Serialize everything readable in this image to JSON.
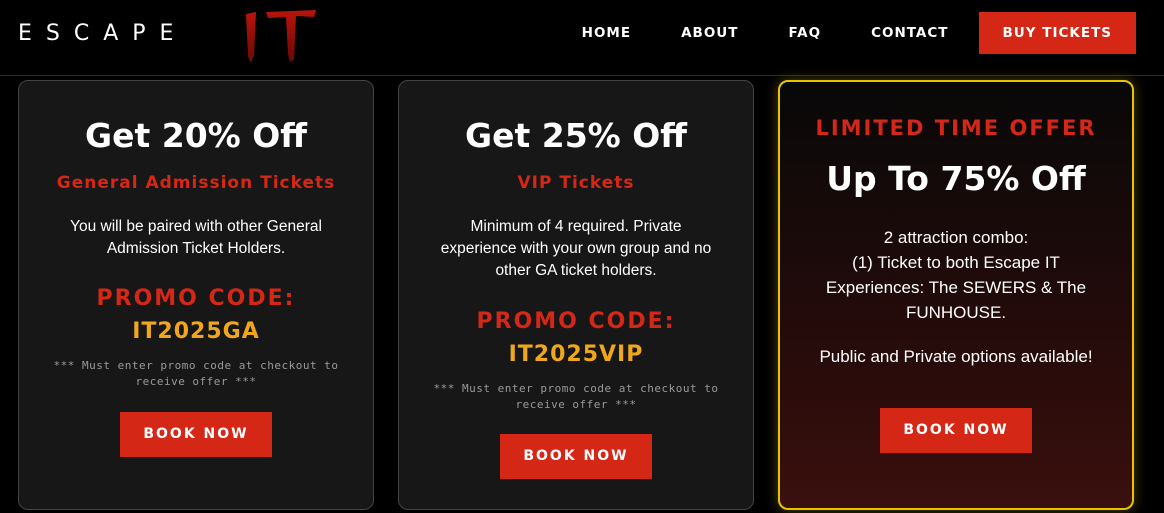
{
  "brand": {
    "logo_text": "ESCAPE",
    "logo_it": "IT"
  },
  "nav": {
    "items": [
      "HOME",
      "ABOUT",
      "FAQ",
      "CONTACT"
    ],
    "buy_label": "BUY TICKETS"
  },
  "cards": [
    {
      "title": "Get 20% Off",
      "subtitle": "General Admission Tickets",
      "desc": [
        "You will be paired with other General",
        "Admission Ticket Holders."
      ],
      "promo_label": "PROMO CODE:",
      "promo_code": "IT2025GA",
      "note": [
        "*** Must enter promo code at checkout to",
        "receive offer ***"
      ],
      "button": "BOOK NOW"
    },
    {
      "title": "Get 25% Off",
      "subtitle": "VIP Tickets",
      "desc": [
        "Minimum of 4 required. Private",
        "experience with your own group and no",
        "other GA ticket holders."
      ],
      "promo_label": "PROMO CODE:",
      "promo_code": "IT2025VIP",
      "note": [
        "*** Must enter promo code at checkout to",
        "receive offer ***"
      ],
      "button": "BOOK NOW"
    },
    {
      "badge": "LIMITED TIME OFFER",
      "title": "Up To 75% Off",
      "desc": [
        "2 attraction combo:",
        "(1) Ticket to both Escape IT",
        "Experiences: The SEWERS & The",
        "FUNHOUSE."
      ],
      "extra": "Public and Private options available!",
      "button": "BOOK NOW"
    }
  ],
  "colors": {
    "accent": "#d42716",
    "promo": "#f0a81a",
    "highlight_border": "#e8c400"
  }
}
